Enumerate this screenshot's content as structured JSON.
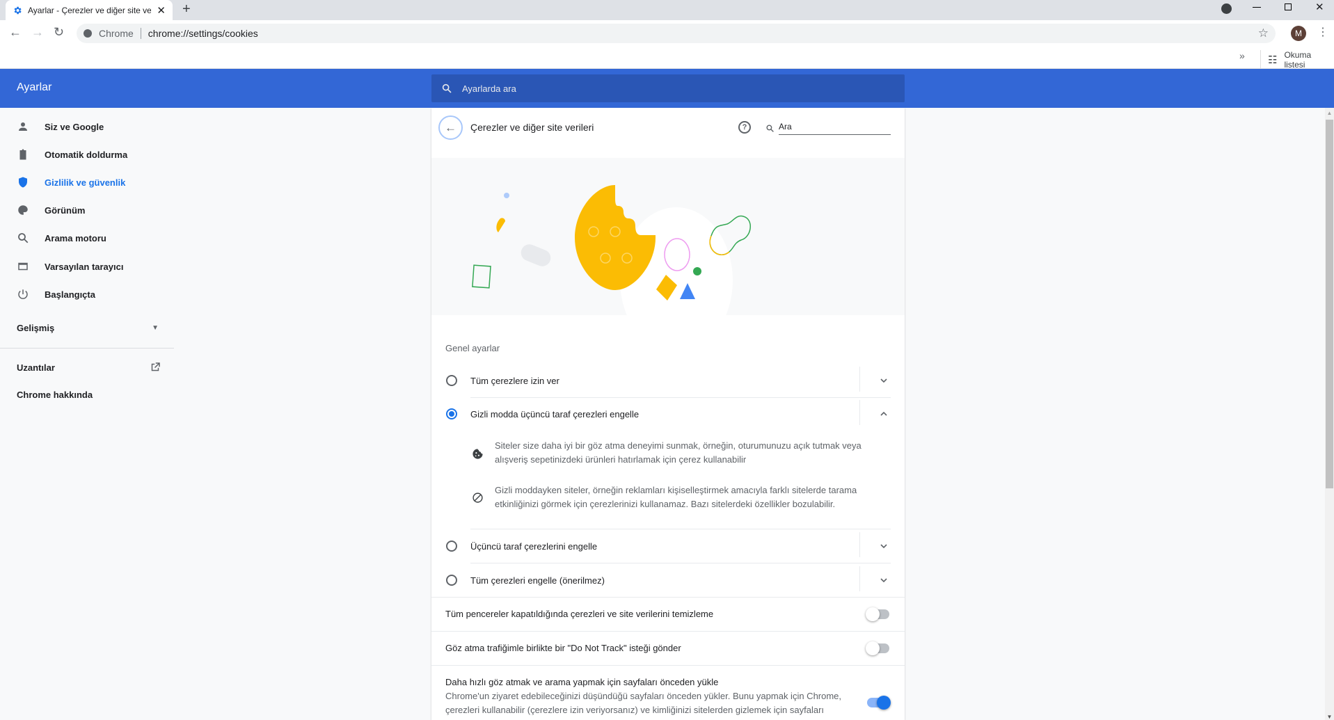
{
  "browser": {
    "tab_title": "Ayarlar - Çerezler ve diğer site verileri",
    "omnibox_chip": "Chrome",
    "url": "chrome://settings/cookies",
    "avatar_letter": "M",
    "reading_list": "Okuma listesi"
  },
  "header": {
    "title": "Ayarlar",
    "search_placeholder": "Ayarlarda ara"
  },
  "sidebar": {
    "items": [
      {
        "label": "Siz ve Google",
        "icon": "person-icon"
      },
      {
        "label": "Otomatik doldurma",
        "icon": "clipboard-icon"
      },
      {
        "label": "Gizlilik ve güvenlik",
        "icon": "shield-icon",
        "active": true
      },
      {
        "label": "Görünüm",
        "icon": "palette-icon"
      },
      {
        "label": "Arama motoru",
        "icon": "search-icon"
      },
      {
        "label": "Varsayılan tarayıcı",
        "icon": "browser-icon"
      },
      {
        "label": "Başlangıçta",
        "icon": "power-icon"
      }
    ],
    "advanced": "Gelişmiş",
    "extensions": "Uzantılar",
    "about": "Chrome hakkında"
  },
  "page": {
    "title": "Çerezler ve diğer site verileri",
    "search_placeholder": "Ara",
    "section": "Genel ayarlar",
    "options": [
      {
        "label": "Tüm çerezlere izin ver",
        "selected": false
      },
      {
        "label": "Gizli modda üçüncü taraf çerezleri engelle",
        "selected": true
      },
      {
        "label": "Üçüncü taraf çerezlerini engelle",
        "selected": false
      },
      {
        "label": "Tüm çerezleri engelle (önerilmez)",
        "selected": false
      }
    ],
    "details": [
      "Siteler size daha iyi bir göz atma deneyimi sunmak, örneğin, oturumunuzu açık tutmak veya alışveriş sepetinizdeki ürünleri hatırlamak için çerez kullanabilir",
      "Gizli moddayken siteler, örneğin reklamları kişiselleştirmek amacıyla farklı sitelerde tarama etkinliğinizi görmek için çerezlerinizi kullanamaz. Bazı sitelerdeki özellikler bozulabilir."
    ],
    "toggles": [
      {
        "label": "Tüm pencereler kapatıldığında çerezleri ve site verilerini temizleme",
        "on": false
      },
      {
        "label": "Göz atma trafiğimle birlikte bir \"Do Not Track\" isteği gönder",
        "on": false
      }
    ],
    "preload": {
      "label": "Daha hızlı göz atmak ve arama yapmak için sayfaları önceden yükle",
      "desc": "Chrome'un ziyaret edebileceğinizi düşündüğü sayfaları önceden yükler. Bunu yapmak için Chrome, çerezleri kullanabilir (çerezlere izin veriyorsanız) ve kimliğinizi sitelerden gizlemek için sayfaları",
      "on": true
    }
  },
  "colors": {
    "accent": "#1a73e8",
    "header": "#3367d6"
  }
}
